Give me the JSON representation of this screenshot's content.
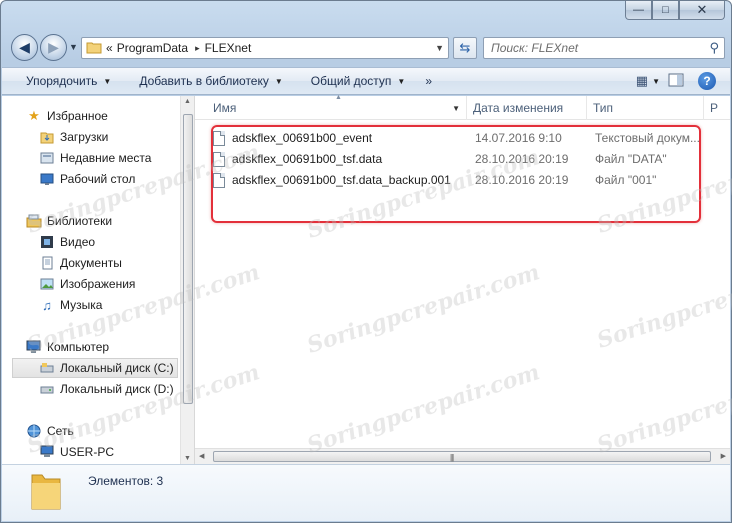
{
  "window": {
    "caption_buttons": {
      "minimize": "—",
      "maximize": "□",
      "close": "✕"
    }
  },
  "address_bar": {
    "chevron": "«",
    "segments": [
      "ProgramData",
      "FLEXnet"
    ],
    "separator": "▸"
  },
  "search": {
    "placeholder": "Поиск: FLEXnet"
  },
  "toolbar": {
    "organize": "Упорядочить",
    "add_to_library": "Добавить в библиотеку",
    "share": "Общий доступ",
    "more": "»"
  },
  "sidebar": {
    "favorites": {
      "label": "Избранное",
      "items": [
        "Загрузки",
        "Недавние места",
        "Рабочий стол"
      ]
    },
    "libraries": {
      "label": "Библиотеки",
      "items": [
        "Видео",
        "Документы",
        "Изображения",
        "Музыка"
      ]
    },
    "computer": {
      "label": "Компьютер",
      "items": [
        "Локальный диск (C:)",
        "Локальный диск (D:)"
      ]
    },
    "network": {
      "label": "Сеть",
      "items": [
        "USER-PC"
      ]
    }
  },
  "columns": {
    "name": "Имя",
    "date": "Дата изменения",
    "type": "Тип",
    "more": "Р"
  },
  "files": [
    {
      "name": "adskflex_00691b00_event",
      "date": "14.07.2016 9:10",
      "type": "Текстовый докум..."
    },
    {
      "name": "adskflex_00691b00_tsf.data",
      "date": "28.10.2016 20:19",
      "type": "Файл \"DATA\""
    },
    {
      "name": "adskflex_00691b00_tsf.data_backup.001",
      "date": "28.10.2016 20:19",
      "type": "Файл \"001\""
    }
  ],
  "details": {
    "count": "Элементов: 3"
  },
  "watermark": "Soringpcrepair.com",
  "colors": {
    "highlight": "#e3303a",
    "accent": "#1c58b0"
  }
}
